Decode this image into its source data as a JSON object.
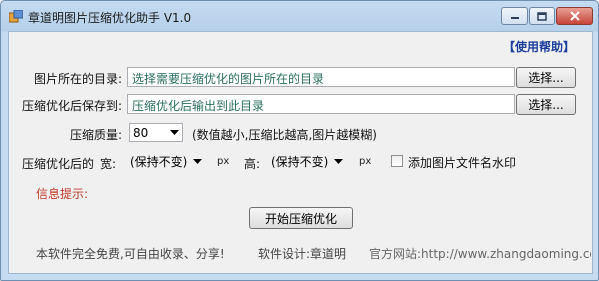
{
  "window": {
    "title": "章道明图片压缩优化助手 V1.0"
  },
  "icons": {
    "app": "app-icon",
    "minimize": "minimize-icon",
    "maximize": "maximize-icon",
    "close": "close-icon",
    "dropdown": "chevron-down-icon"
  },
  "colors": {
    "help_link": "#1c3f9b",
    "info_label": "#c0392b",
    "path_text": "#2a6f60"
  },
  "help_link": "【使用帮助】",
  "source": {
    "label": "图片所在的目录:",
    "value": "选择需要压缩优化的图片所在的目录",
    "browse_label": "选择..."
  },
  "output": {
    "label": "压缩优化后保存到:",
    "value": "压缩优化后输出到此目录",
    "browse_label": "选择..."
  },
  "quality": {
    "label": "压缩质量:",
    "value": "80",
    "hint": "(数值越小,压缩比越高,图片越模糊)"
  },
  "size": {
    "label": "压缩优化后的",
    "width_label": "宽:",
    "width_value": "(保持不变)",
    "width_unit": "px",
    "height_label": "高:",
    "height_value": "(保持不变)",
    "height_unit": "px"
  },
  "watermark": {
    "label": "添加图片文件名水印",
    "checked": false
  },
  "info": {
    "label": "信息提示:"
  },
  "start_button": "开始压缩优化",
  "footer": {
    "free_text": "本软件完全免费,可自由收录、分享!",
    "designer": "软件设计:章道明",
    "site": "官方网站:http://www.zhangdaoming.com"
  }
}
